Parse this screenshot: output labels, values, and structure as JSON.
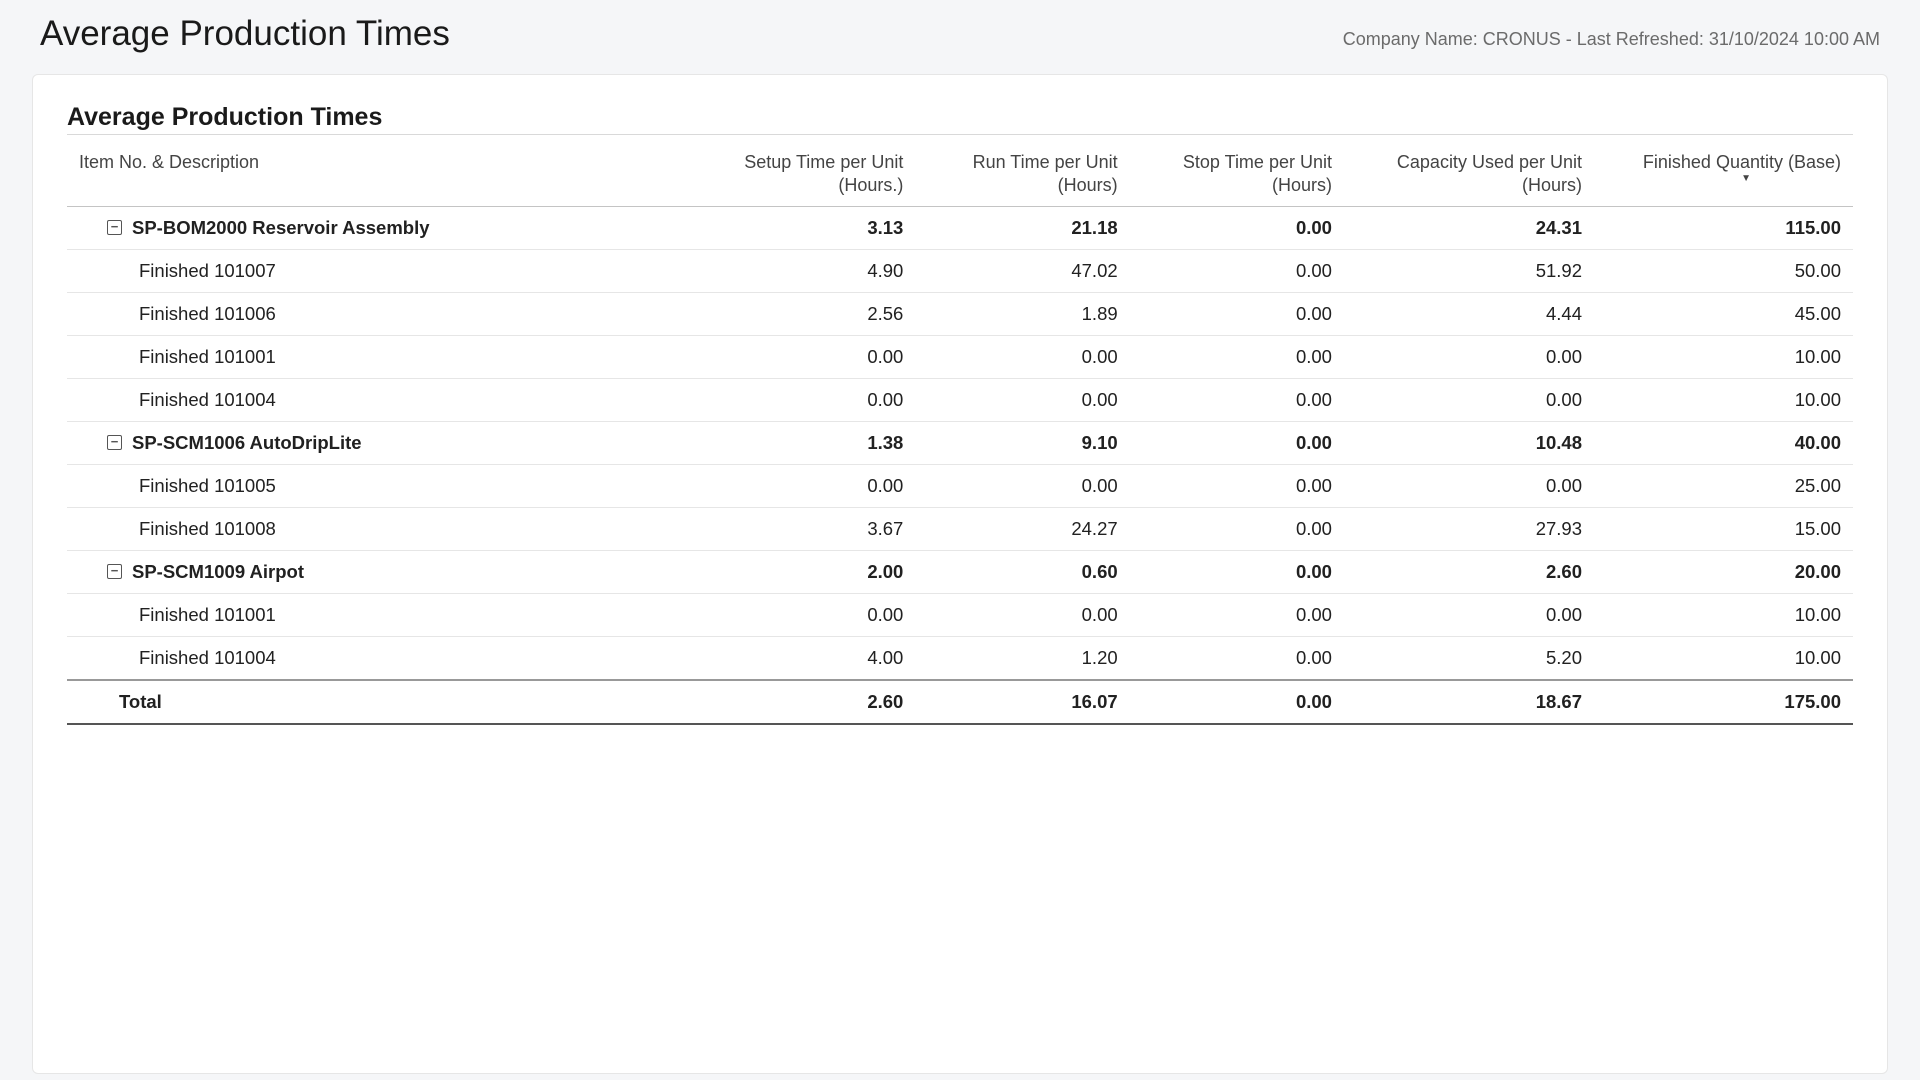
{
  "page": {
    "title": "Average Production Times",
    "meta": "Company Name: CRONUS - Last Refreshed: 31/10/2024 10:00 AM"
  },
  "card": {
    "title": "Average Production Times"
  },
  "columns": {
    "item": "Item No. & Description",
    "setup": "Setup Time per Unit (Hours.)",
    "run": "Run Time per Unit (Hours)",
    "stop": "Stop Time per Unit (Hours)",
    "cap": "Capacity Used per Unit (Hours)",
    "qty": "Finished Quantity (Base)"
  },
  "rows": [
    {
      "type": "group",
      "label": "SP-BOM2000 Reservoir Assembly",
      "setup": "3.13",
      "run": "21.18",
      "stop": "0.00",
      "cap": "24.31",
      "qty": "115.00"
    },
    {
      "type": "child",
      "label": "Finished 101007",
      "setup": "4.90",
      "run": "47.02",
      "stop": "0.00",
      "cap": "51.92",
      "qty": "50.00"
    },
    {
      "type": "child",
      "label": "Finished 101006",
      "setup": "2.56",
      "run": "1.89",
      "stop": "0.00",
      "cap": "4.44",
      "qty": "45.00"
    },
    {
      "type": "child",
      "label": "Finished 101001",
      "setup": "0.00",
      "run": "0.00",
      "stop": "0.00",
      "cap": "0.00",
      "qty": "10.00"
    },
    {
      "type": "child",
      "label": "Finished 101004",
      "setup": "0.00",
      "run": "0.00",
      "stop": "0.00",
      "cap": "0.00",
      "qty": "10.00"
    },
    {
      "type": "group",
      "label": "SP-SCM1006 AutoDripLite",
      "setup": "1.38",
      "run": "9.10",
      "stop": "0.00",
      "cap": "10.48",
      "qty": "40.00"
    },
    {
      "type": "child",
      "label": "Finished 101005",
      "setup": "0.00",
      "run": "0.00",
      "stop": "0.00",
      "cap": "0.00",
      "qty": "25.00"
    },
    {
      "type": "child",
      "label": "Finished 101008",
      "setup": "3.67",
      "run": "24.27",
      "stop": "0.00",
      "cap": "27.93",
      "qty": "15.00"
    },
    {
      "type": "group",
      "label": "SP-SCM1009 Airpot",
      "setup": "2.00",
      "run": "0.60",
      "stop": "0.00",
      "cap": "2.60",
      "qty": "20.00"
    },
    {
      "type": "child",
      "label": "Finished 101001",
      "setup": "0.00",
      "run": "0.00",
      "stop": "0.00",
      "cap": "0.00",
      "qty": "10.00"
    },
    {
      "type": "child",
      "label": "Finished 101004",
      "setup": "4.00",
      "run": "1.20",
      "stop": "0.00",
      "cap": "5.20",
      "qty": "10.00"
    },
    {
      "type": "total",
      "label": "Total",
      "setup": "2.60",
      "run": "16.07",
      "stop": "0.00",
      "cap": "18.67",
      "qty": "175.00"
    }
  ],
  "chart_data": {
    "type": "table",
    "title": "Average Production Times",
    "columns": [
      "Item No. & Description",
      "Setup Time per Unit (Hours.)",
      "Run Time per Unit (Hours)",
      "Stop Time per Unit (Hours)",
      "Capacity Used per Unit (Hours)",
      "Finished Quantity (Base)"
    ],
    "rows": [
      [
        "SP-BOM2000 Reservoir Assembly",
        3.13,
        21.18,
        0.0,
        24.31,
        115.0
      ],
      [
        "Finished 101007",
        4.9,
        47.02,
        0.0,
        51.92,
        50.0
      ],
      [
        "Finished 101006",
        2.56,
        1.89,
        0.0,
        4.44,
        45.0
      ],
      [
        "Finished 101001",
        0.0,
        0.0,
        0.0,
        0.0,
        10.0
      ],
      [
        "Finished 101004",
        0.0,
        0.0,
        0.0,
        0.0,
        10.0
      ],
      [
        "SP-SCM1006 AutoDripLite",
        1.38,
        9.1,
        0.0,
        10.48,
        40.0
      ],
      [
        "Finished 101005",
        0.0,
        0.0,
        0.0,
        0.0,
        25.0
      ],
      [
        "Finished 101008",
        3.67,
        24.27,
        0.0,
        27.93,
        15.0
      ],
      [
        "SP-SCM1009 Airpot",
        2.0,
        0.6,
        0.0,
        2.6,
        20.0
      ],
      [
        "Finished 101001",
        0.0,
        0.0,
        0.0,
        0.0,
        10.0
      ],
      [
        "Finished 101004",
        4.0,
        1.2,
        0.0,
        5.2,
        10.0
      ],
      [
        "Total",
        2.6,
        16.07,
        0.0,
        18.67,
        175.0
      ]
    ]
  }
}
